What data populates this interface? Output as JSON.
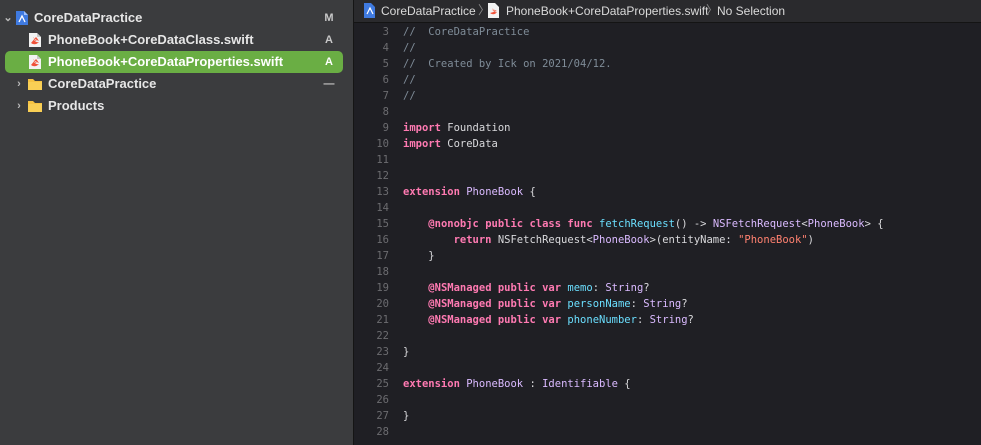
{
  "navigator": {
    "items": [
      {
        "label": "CoreDataPractice",
        "badge": "M",
        "icon": "project-icon",
        "disclosure": "⌄"
      },
      {
        "label": "PhoneBook+CoreDataClass.swift",
        "badge": "A",
        "icon": "swift-file-icon"
      },
      {
        "label": "PhoneBook+CoreDataProperties.swift",
        "badge": "A",
        "icon": "swift-file-icon",
        "selected": true
      },
      {
        "label": "CoreDataPractice",
        "badge": "—",
        "icon": "folder-icon",
        "disclosure": "›"
      },
      {
        "label": "Products",
        "badge": "",
        "icon": "folder-icon",
        "disclosure": "›"
      }
    ]
  },
  "jumpbar": {
    "project": "CoreDataPractice",
    "file": "PhoneBook+CoreDataProperties.swift",
    "selection": "No Selection"
  },
  "colors": {
    "selection": "#6aae44",
    "keyword": "#ff7ab2",
    "type": "#dabaff",
    "function": "#6bdfff",
    "string": "#ff8170",
    "comment": "#7f8c98"
  },
  "editor": {
    "lines": [
      {
        "num": "3",
        "tokens": [
          {
            "t": "//  CoreDataPractice",
            "c": "cm"
          }
        ]
      },
      {
        "num": "4",
        "tokens": [
          {
            "t": "//",
            "c": "cm"
          }
        ]
      },
      {
        "num": "5",
        "tokens": [
          {
            "t": "//  Created by Ick on 2021/04/12.",
            "c": "cm"
          }
        ]
      },
      {
        "num": "6",
        "tokens": [
          {
            "t": "//",
            "c": "cm"
          }
        ]
      },
      {
        "num": "7",
        "tokens": [
          {
            "t": "//",
            "c": "cm"
          }
        ]
      },
      {
        "num": "8",
        "tokens": []
      },
      {
        "num": "9",
        "tokens": [
          {
            "t": "import",
            "c": "kw"
          },
          {
            "t": " Foundation",
            "c": "pl"
          }
        ]
      },
      {
        "num": "10",
        "tokens": [
          {
            "t": "import",
            "c": "kw"
          },
          {
            "t": " CoreData",
            "c": "pl"
          }
        ]
      },
      {
        "num": "11",
        "tokens": []
      },
      {
        "num": "12",
        "tokens": []
      },
      {
        "num": "13",
        "tokens": [
          {
            "t": "extension",
            "c": "kw"
          },
          {
            "t": " ",
            "c": "pl"
          },
          {
            "t": "PhoneBook",
            "c": "ty"
          },
          {
            "t": " {",
            "c": "pl"
          }
        ]
      },
      {
        "num": "14",
        "tokens": []
      },
      {
        "num": "15",
        "tokens": [
          {
            "t": "    ",
            "c": "pl"
          },
          {
            "t": "@nonobjc",
            "c": "attr"
          },
          {
            "t": " ",
            "c": "pl"
          },
          {
            "t": "public",
            "c": "kw"
          },
          {
            "t": " ",
            "c": "pl"
          },
          {
            "t": "class",
            "c": "kw"
          },
          {
            "t": " ",
            "c": "pl"
          },
          {
            "t": "func",
            "c": "kw"
          },
          {
            "t": " ",
            "c": "pl"
          },
          {
            "t": "fetchRequest",
            "c": "fn"
          },
          {
            "t": "() -> ",
            "c": "pl"
          },
          {
            "t": "NSFetchRequest",
            "c": "ty"
          },
          {
            "t": "<",
            "c": "pl"
          },
          {
            "t": "PhoneBook",
            "c": "ty"
          },
          {
            "t": "> {",
            "c": "pl"
          }
        ]
      },
      {
        "num": "16",
        "tokens": [
          {
            "t": "        ",
            "c": "pl"
          },
          {
            "t": "return",
            "c": "kw"
          },
          {
            "t": " NSFetchRequest<",
            "c": "pl"
          },
          {
            "t": "PhoneBook",
            "c": "ty"
          },
          {
            "t": ">(entityName: ",
            "c": "pl"
          },
          {
            "t": "\"PhoneBook\"",
            "c": "str"
          },
          {
            "t": ")",
            "c": "pl"
          }
        ]
      },
      {
        "num": "17",
        "tokens": [
          {
            "t": "    }",
            "c": "pl"
          }
        ]
      },
      {
        "num": "18",
        "tokens": []
      },
      {
        "num": "19",
        "tokens": [
          {
            "t": "    ",
            "c": "pl"
          },
          {
            "t": "@NSManaged",
            "c": "attr"
          },
          {
            "t": " ",
            "c": "pl"
          },
          {
            "t": "public",
            "c": "kw"
          },
          {
            "t": " ",
            "c": "pl"
          },
          {
            "t": "var",
            "c": "kw"
          },
          {
            "t": " ",
            "c": "pl"
          },
          {
            "t": "memo",
            "c": "fn"
          },
          {
            "t": ": ",
            "c": "pl"
          },
          {
            "t": "String",
            "c": "ty"
          },
          {
            "t": "?",
            "c": "pl"
          }
        ]
      },
      {
        "num": "20",
        "tokens": [
          {
            "t": "    ",
            "c": "pl"
          },
          {
            "t": "@NSManaged",
            "c": "attr"
          },
          {
            "t": " ",
            "c": "pl"
          },
          {
            "t": "public",
            "c": "kw"
          },
          {
            "t": " ",
            "c": "pl"
          },
          {
            "t": "var",
            "c": "kw"
          },
          {
            "t": " ",
            "c": "pl"
          },
          {
            "t": "personName",
            "c": "fn"
          },
          {
            "t": ": ",
            "c": "pl"
          },
          {
            "t": "String",
            "c": "ty"
          },
          {
            "t": "?",
            "c": "pl"
          }
        ]
      },
      {
        "num": "21",
        "tokens": [
          {
            "t": "    ",
            "c": "pl"
          },
          {
            "t": "@NSManaged",
            "c": "attr"
          },
          {
            "t": " ",
            "c": "pl"
          },
          {
            "t": "public",
            "c": "kw"
          },
          {
            "t": " ",
            "c": "pl"
          },
          {
            "t": "var",
            "c": "kw"
          },
          {
            "t": " ",
            "c": "pl"
          },
          {
            "t": "phoneNumber",
            "c": "fn"
          },
          {
            "t": ": ",
            "c": "pl"
          },
          {
            "t": "String",
            "c": "ty"
          },
          {
            "t": "?",
            "c": "pl"
          }
        ]
      },
      {
        "num": "22",
        "tokens": []
      },
      {
        "num": "23",
        "tokens": [
          {
            "t": "}",
            "c": "pl"
          }
        ]
      },
      {
        "num": "24",
        "tokens": []
      },
      {
        "num": "25",
        "tokens": [
          {
            "t": "extension",
            "c": "kw"
          },
          {
            "t": " ",
            "c": "pl"
          },
          {
            "t": "PhoneBook",
            "c": "ty"
          },
          {
            "t": " : ",
            "c": "pl"
          },
          {
            "t": "Identifiable",
            "c": "ty"
          },
          {
            "t": " {",
            "c": "pl"
          }
        ]
      },
      {
        "num": "26",
        "tokens": []
      },
      {
        "num": "27",
        "tokens": [
          {
            "t": "}",
            "c": "pl"
          }
        ]
      },
      {
        "num": "28",
        "tokens": []
      }
    ]
  }
}
